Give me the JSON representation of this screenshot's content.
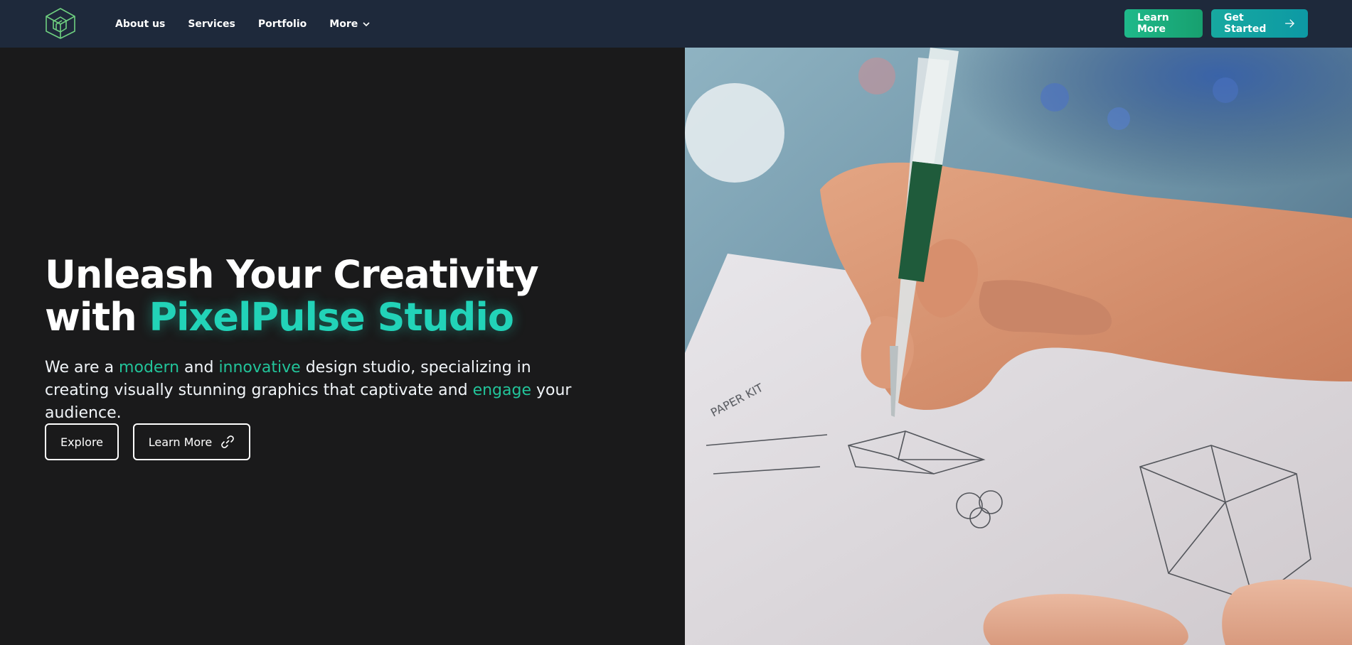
{
  "brand": {
    "logo_icon": "isometric-cube-logo-icon",
    "color": "#6fd080"
  },
  "nav": {
    "items": [
      {
        "label": "About us"
      },
      {
        "label": "Services"
      },
      {
        "label": "Portfolio"
      },
      {
        "label": "More",
        "icon": "chevron-down-icon"
      }
    ],
    "learn_more_label": "Learn More",
    "get_started_label": "Get Started",
    "get_started_icon": "arrow-right-icon"
  },
  "hero": {
    "headline_line1": "Unleash Your Creativity",
    "headline_with": "with ",
    "headline_brand": "PixelPulse Studio",
    "tagline": {
      "p1": "We are a ",
      "h1": "modern",
      "p2": " and ",
      "h2": "innovative",
      "p3": " design studio, specializing in creating visually stunning graphics that captivate and ",
      "h3": "engage",
      "p4": " your audience."
    },
    "explore_label": "Explore",
    "learn_more_label": "Learn More",
    "learn_more_icon": "link-icon"
  },
  "colors": {
    "navbar_bg": "#1e293b",
    "page_bg": "#1a1a1b",
    "accent_teal": "#22d3b8",
    "accent_green": "#22c49a",
    "learn_more_btn": "#1fb98a",
    "get_started_btn": "#17a9a0"
  },
  "image": {
    "subject": "hand-sketching-with-pen-image"
  }
}
